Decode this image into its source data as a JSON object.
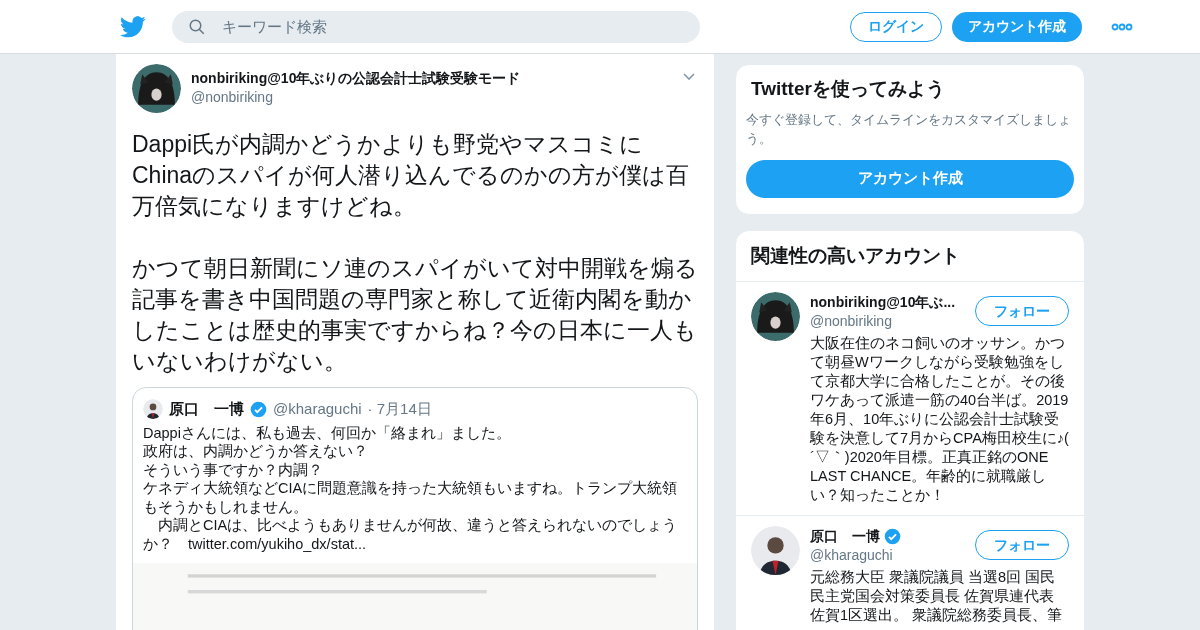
{
  "header": {
    "search": {
      "placeholder": "キーワード検索"
    },
    "login": "ログイン",
    "signup": "アカウント作成"
  },
  "tweet": {
    "name": "nonbiriking@10年ぶりの公認会計士試験受験モード",
    "handle": "@nonbiriking",
    "paragraphs": [
      "Dappi氏が内調かどうかよりも野党やマスコミにChinaのスパイが何人潜り込んでるのかの方が僕は百万倍気になりますけどね。",
      "かつて朝日新聞にソ連のスパイがいて対中開戦を煽る記事を書き中国問題の専門家と称して近衛内閣を動かしたことは歴史的事実ですからね？今の日本に一人もいないわけがない。"
    ],
    "quote": {
      "name": "原口　一博",
      "verified": true,
      "handle": "@kharaguchi",
      "date": "· 7月14日",
      "lines": [
        "Dappiさんには、私も過去、何回か「絡まれ」ました。",
        "政府は、内調かどうか答えない？",
        "そういう事ですか？内調？",
        "ケネディ大統領などCIAに問題意識を持った大統領もいますね。トランプ大統領もそうかもしれません。",
        "　内調とCIAは、比べようもありませんが何故、違うと答えられないのでしょうか？"
      ],
      "link": "twitter.com/yukiho_dx/stat..."
    }
  },
  "signup_card": {
    "title": "Twitterを使ってみよう",
    "text": "今すぐ登録して、タイムラインをカスタマイズしましょう。",
    "button": "アカウント作成"
  },
  "related": {
    "title": "関連性の高いアカウント",
    "accounts": [
      {
        "kind": "cat",
        "name": "nonbiriking@10年ぶ...",
        "verified": false,
        "handle": "@nonbiriking",
        "follow": "フォロー",
        "bio": "大阪在住のネコ飼いのオッサン。かつて朝昼Wワークしながら受験勉強をして京都大学に合格したことが。その後ワケあって派遣一筋の40台半ば。2019年6月、10年ぶりに公認会計士試験受験を決意して7月からCPA梅田校生に♪( ´▽｀)2020年目標。正真正銘のONE LAST CHANCE。年齢的に就職厳しい？知ったことか！"
      },
      {
        "kind": "person",
        "name": "原口　一博",
        "verified": true,
        "handle": "@kharaguchi",
        "follow": "フォロー",
        "bio": "元総務大臣 衆議院議員 当選8回 国民民主党国会対策委員長 佐賀県連代表佐賀1区選出。 衆議院総務委員長、筆"
      }
    ]
  }
}
